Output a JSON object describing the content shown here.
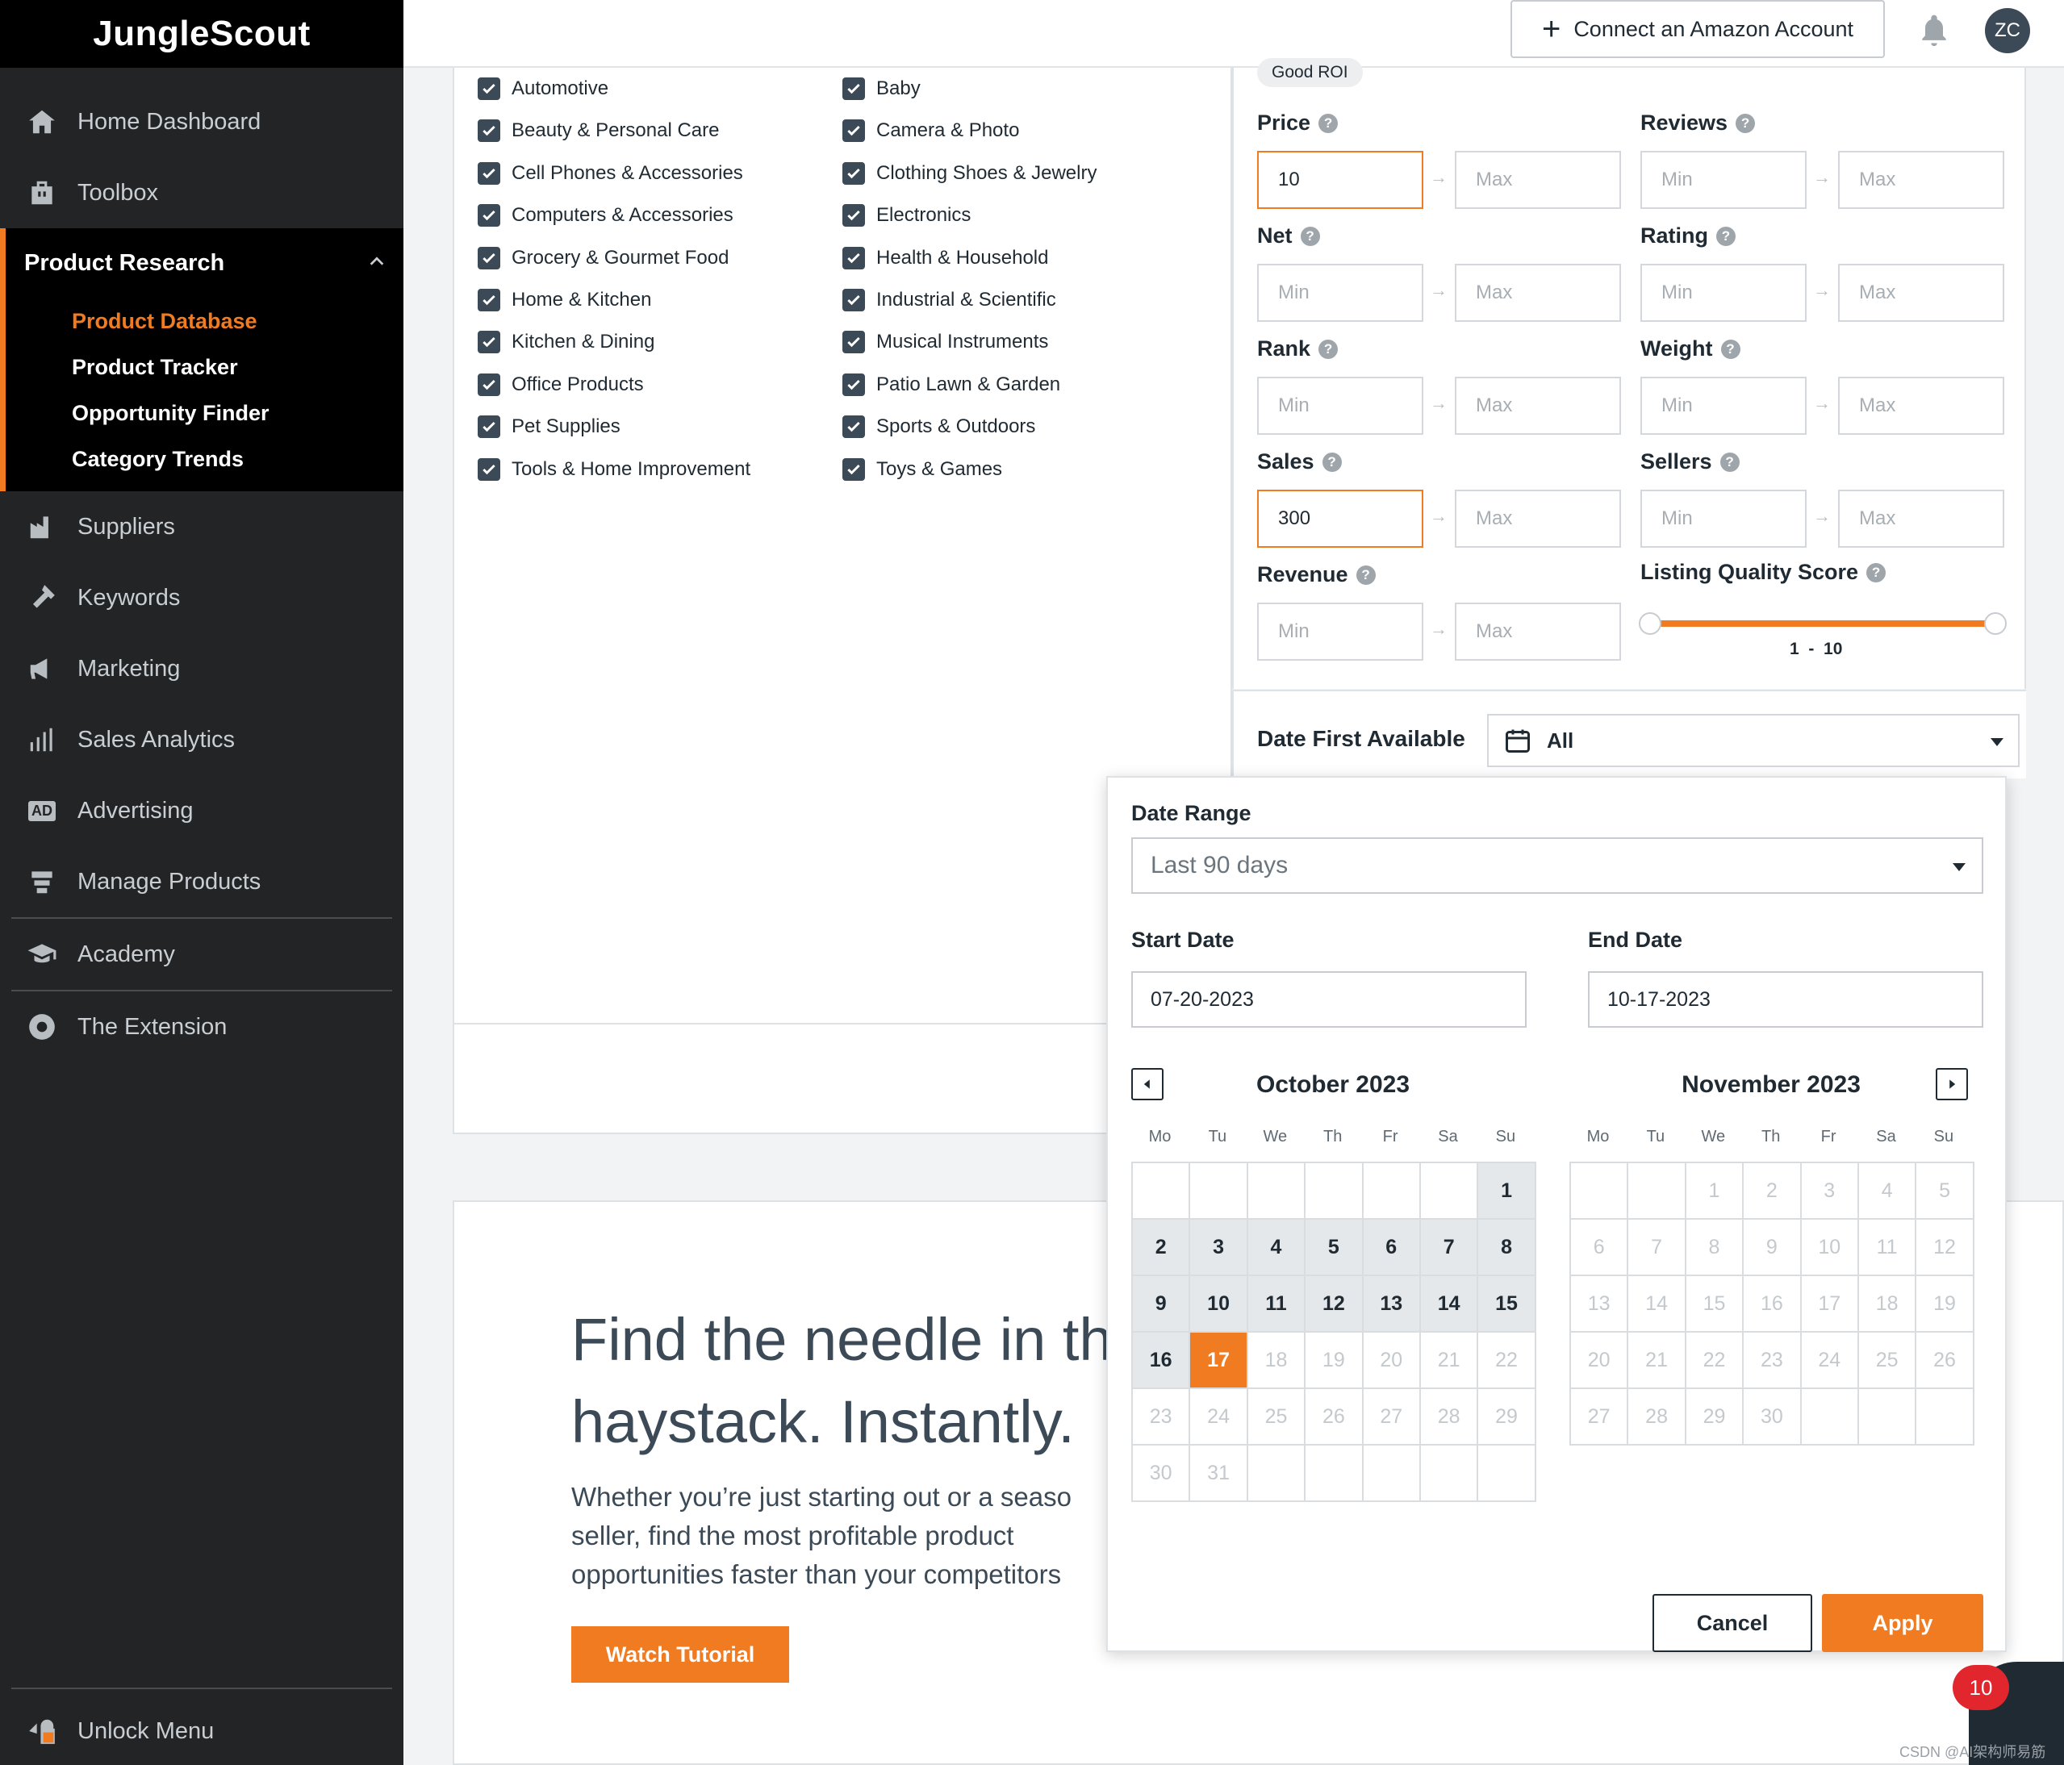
{
  "brand": {
    "logo_text": "JungleScout"
  },
  "sidebar": {
    "items": [
      {
        "label": "Home Dashboard",
        "icon": "home-icon"
      },
      {
        "label": "Toolbox",
        "icon": "toolbox-icon"
      },
      {
        "label": "Product Research",
        "icon": "search-icon"
      },
      {
        "label": "Suppliers",
        "icon": "factory-icon"
      },
      {
        "label": "Keywords",
        "icon": "hammer-icon"
      },
      {
        "label": "Marketing",
        "icon": "megaphone-icon"
      },
      {
        "label": "Sales Analytics",
        "icon": "bar-chart-icon"
      },
      {
        "label": "Advertising",
        "icon": "ad-icon"
      },
      {
        "label": "Manage Products",
        "icon": "stack-icon"
      },
      {
        "label": "Academy",
        "icon": "graduation-cap-icon"
      },
      {
        "label": "The Extension",
        "icon": "chrome-icon"
      },
      {
        "label": "Unlock Menu",
        "icon": "lock-icon"
      }
    ],
    "sub_items": [
      "Product Database",
      "Product Tracker",
      "Opportunity Finder",
      "Category Trends"
    ],
    "ad_icon_text": "AD"
  },
  "topbar": {
    "connect_label": "Connect an Amazon Account",
    "avatar_initials": "ZC"
  },
  "categories": {
    "left": [
      "Automotive",
      "Beauty & Personal Care",
      "Cell Phones & Accessories",
      "Computers & Accessories",
      "Grocery & Gourmet Food",
      "Home & Kitchen",
      "Kitchen & Dining",
      "Office Products",
      "Pet Supplies",
      "Tools & Home Improvement"
    ],
    "right": [
      "Baby",
      "Camera & Photo",
      "Clothing Shoes & Jewelry",
      "Electronics",
      "Health & Household",
      "Industrial & Scientific",
      "Musical Instruments",
      "Patio Lawn & Garden",
      "Sports & Outdoors",
      "Toys & Games"
    ]
  },
  "filters": {
    "tag": "Good ROI",
    "min_placeholder": "Min",
    "max_placeholder": "Max",
    "fields": [
      {
        "label": "Price",
        "min": "10",
        "max": ""
      },
      {
        "label": "Reviews",
        "min": "",
        "max": ""
      },
      {
        "label": "Net",
        "min": "",
        "max": ""
      },
      {
        "label": "Rating",
        "min": "",
        "max": ""
      },
      {
        "label": "Rank",
        "min": "",
        "max": ""
      },
      {
        "label": "Weight",
        "min": "",
        "max": ""
      },
      {
        "label": "Sales",
        "min": "300",
        "max": ""
      },
      {
        "label": "Sellers",
        "min": "",
        "max": ""
      },
      {
        "label": "Revenue",
        "min": "",
        "max": ""
      }
    ],
    "lqs": {
      "label": "Listing Quality Score",
      "low": 1,
      "high": 10,
      "range_text": "1  -  10"
    },
    "date_first_available": {
      "label": "Date First Available",
      "value": "All"
    }
  },
  "popup": {
    "date_range_label": "Date Range",
    "date_range_value": "Last 90 days",
    "start_label": "Start Date",
    "start_value": "07-20-2023",
    "end_label": "End Date",
    "end_value": "10-17-2023",
    "weekdays": [
      "Mo",
      "Tu",
      "We",
      "Th",
      "Fr",
      "Sa",
      "Su"
    ],
    "months": [
      {
        "title": "October 2023",
        "offset": 6,
        "days": 31,
        "range_end": 16,
        "selected": 17
      },
      {
        "title": "November 2023",
        "offset": 2,
        "days": 30,
        "range_end": 0,
        "selected": 0
      }
    ],
    "cancel_label": "Cancel",
    "apply_label": "Apply"
  },
  "hero": {
    "title_line1": "Find the needle in th",
    "title_line2": "haystack. Instantly.",
    "sub_line1": "Whether you’re just starting out or a seaso",
    "sub_line2": "seller, find the most profitable product",
    "sub_line3": "opportunities faster than your competitors",
    "button_label": "Watch Tutorial"
  },
  "chat": {
    "badge_count": "10"
  },
  "watermark": "CSDN @AI架构师易筋"
}
